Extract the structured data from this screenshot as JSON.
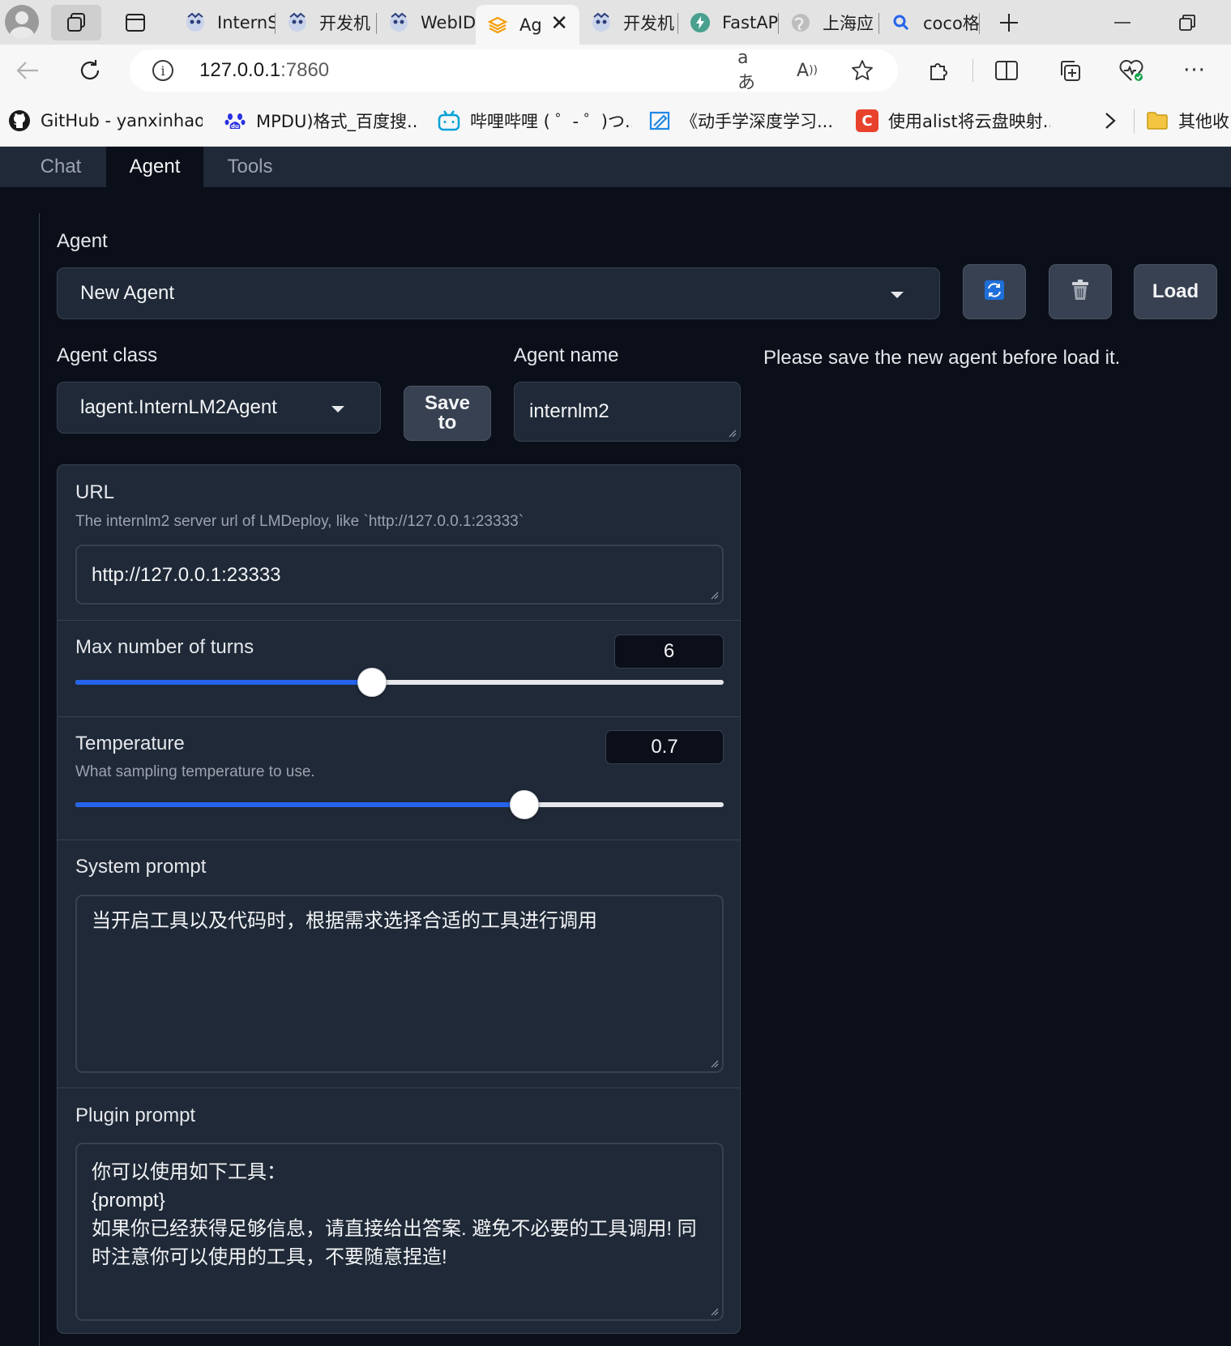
{
  "browser": {
    "tabs": [
      {
        "title": "InternS",
        "icon": "mascot-icon"
      },
      {
        "title": "开发机",
        "icon": "mascot-icon"
      },
      {
        "title": "WebIDE",
        "icon": "mascot-icon"
      },
      {
        "title": "Ag",
        "icon": "layers-icon",
        "active": true
      },
      {
        "title": "开发机",
        "icon": "mascot-icon"
      },
      {
        "title": "FastAPI",
        "icon": "fastapi-icon"
      },
      {
        "title": "上海应",
        "icon": "globe-icon"
      },
      {
        "title": "coco格",
        "icon": "search-icon"
      }
    ],
    "url_host": "127.0.0.1",
    "url_port": ":7860",
    "omnibox_icons": [
      "translate-icon",
      "read-aloud-icon",
      "favorite-star-icon"
    ],
    "bookmarks": [
      {
        "label": "GitHub - yanxinhao...",
        "icon": "github-icon"
      },
      {
        "label": "MPDU)格式_百度搜...",
        "icon": "baidu-paw-icon"
      },
      {
        "label": "哔哩哔哩 ( ゜- ゜)つ...",
        "icon": "bilibili-icon"
      },
      {
        "label": "《动手学深度学习...",
        "icon": "d2l-icon"
      },
      {
        "label": "使用alist将云盘映射...",
        "icon": "csdn-icon"
      }
    ],
    "other_bookmarks": "其他收"
  },
  "app": {
    "tabs": [
      "Chat",
      "Agent",
      "Tools"
    ],
    "selected_tab": "Agent",
    "agent_label": "Agent",
    "agent_selected": "New Agent",
    "load_button": "Load",
    "agent_class_label": "Agent class",
    "agent_class_value": "lagent.InternLM2Agent",
    "save_to_line1": "Save",
    "save_to_line2": "to",
    "agent_name_label": "Agent name",
    "agent_name_value": "internlm2",
    "status_message": "Please save the new agent before load it.",
    "url_title": "URL",
    "url_info": "The internlm2 server url of LMDeploy, like `http://127.0.0.1:23333`",
    "url_value": "http://127.0.0.1:23333",
    "max_turns_label": "Max number of turns",
    "max_turns_value": "6",
    "max_turns_fraction": 0.457,
    "temperature_label": "Temperature",
    "temperature_info": "What sampling temperature to use.",
    "temperature_value": "0.7",
    "temperature_fraction": 0.692,
    "system_prompt_label": "System prompt",
    "system_prompt_value": "当开启工具以及代码时，根据需求选择合适的工具进行调用",
    "plugin_prompt_label": "Plugin prompt",
    "plugin_prompt_value": "你可以使用如下工具：\n{prompt}\n如果你已经获得足够信息，请直接给出答案. 避免不必要的工具调用! 同时注意你可以使用的工具，不要随意捏造!"
  },
  "colors": {
    "accent": "#2563eb",
    "background": "#0b0f19",
    "panel": "#1f2937"
  }
}
